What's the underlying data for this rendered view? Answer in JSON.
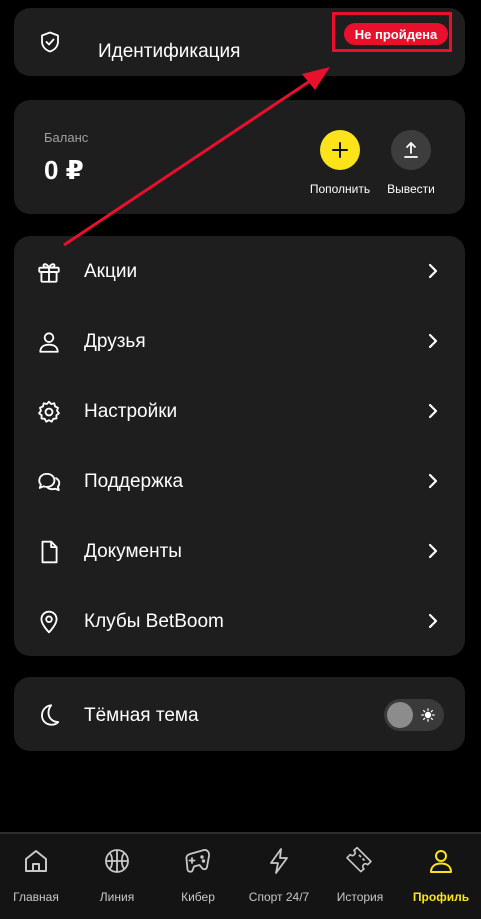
{
  "identification": {
    "label": "Идентификация",
    "status": "Не пройдена"
  },
  "balance": {
    "label": "Баланс",
    "value": "0 ₽",
    "deposit_label": "Пополнить",
    "withdraw_label": "Вывести"
  },
  "menu": {
    "items": [
      {
        "label": "Акции",
        "icon": "gift-icon"
      },
      {
        "label": "Друзья",
        "icon": "user-icon"
      },
      {
        "label": "Настройки",
        "icon": "gear-icon"
      },
      {
        "label": "Поддержка",
        "icon": "chat-icon"
      },
      {
        "label": "Документы",
        "icon": "document-icon"
      },
      {
        "label": "Клубы BetBoom",
        "icon": "map-pin-icon"
      }
    ]
  },
  "theme": {
    "label": "Тёмная тема",
    "enabled": false
  },
  "bottom_nav": {
    "items": [
      {
        "label": "Главная",
        "icon": "home-icon"
      },
      {
        "label": "Линия",
        "icon": "ball-icon"
      },
      {
        "label": "Кибер",
        "icon": "gamepad-icon"
      },
      {
        "label": "Спорт 24/7",
        "icon": "lightning-icon"
      },
      {
        "label": "История",
        "icon": "ticket-icon"
      },
      {
        "label": "Профиль",
        "icon": "profile-icon"
      }
    ],
    "active": "Профиль"
  },
  "colors": {
    "accent": "#fde31a",
    "alert": "#e8102d",
    "card": "#1e1e1e",
    "background": "#000000"
  }
}
